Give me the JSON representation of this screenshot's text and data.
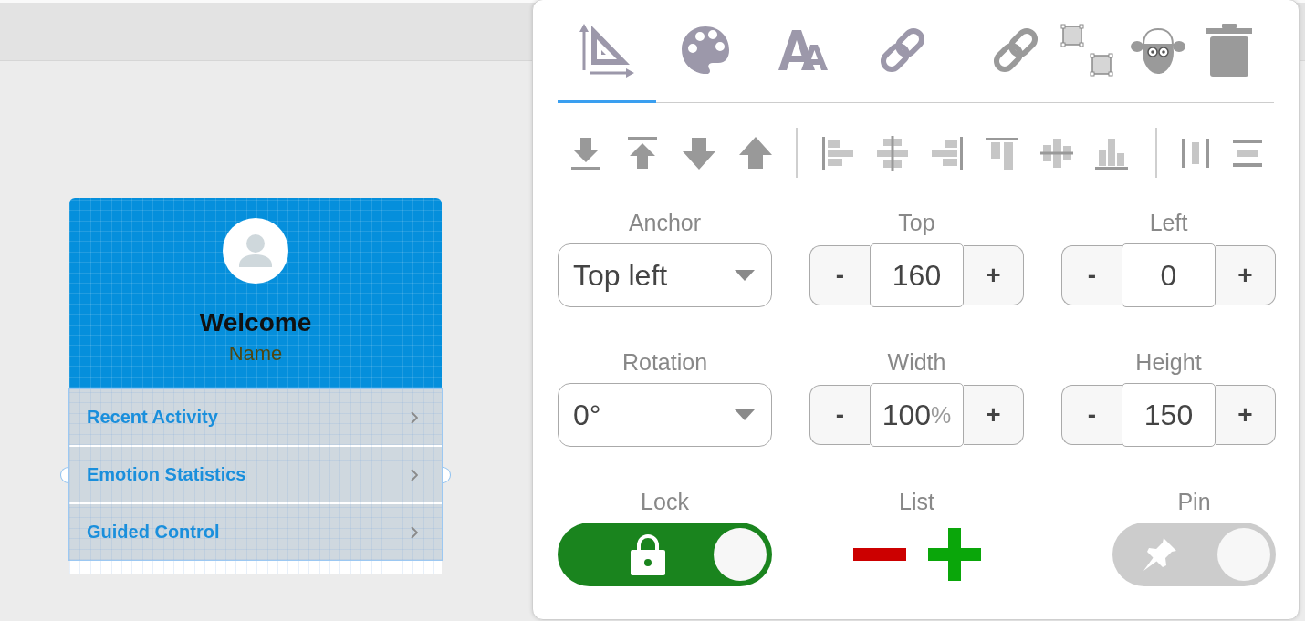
{
  "canvas": {
    "card": {
      "title": "Welcome",
      "subtitle": "Name"
    },
    "menu": {
      "selected": true,
      "items": [
        {
          "label": "Recent Activity"
        },
        {
          "label": "Emotion Statistics"
        },
        {
          "label": "Guided Control"
        }
      ]
    }
  },
  "panel": {
    "tabs": [
      {
        "kind": "layout",
        "selected": true
      },
      {
        "kind": "style",
        "selected": false
      },
      {
        "kind": "typography",
        "selected": false
      },
      {
        "kind": "link",
        "selected": false
      }
    ],
    "actions": [
      {
        "kind": "link"
      },
      {
        "kind": "group"
      },
      {
        "kind": "sheep"
      },
      {
        "kind": "delete"
      }
    ],
    "toolbar": {
      "arrange": [
        {
          "kind": "bottom"
        },
        {
          "kind": "top"
        },
        {
          "kind": "down"
        },
        {
          "kind": "up"
        }
      ],
      "align": [
        {
          "kind": "left"
        },
        {
          "kind": "center"
        },
        {
          "kind": "right"
        },
        {
          "kind": "top"
        },
        {
          "kind": "middle"
        },
        {
          "kind": "bottom"
        }
      ],
      "distribute": [
        {
          "kind": "horizontal"
        },
        {
          "kind": "vertical"
        }
      ]
    },
    "fields": [
      {
        "kind": "select",
        "label": "Anchor",
        "value": "Top left"
      },
      {
        "kind": "stepper",
        "label": "Top",
        "value": "160",
        "decrement": "-",
        "increment": "+"
      },
      {
        "kind": "stepper",
        "label": "Left",
        "value": "0",
        "decrement": "-",
        "increment": "+"
      },
      {
        "kind": "select",
        "label": "Rotation",
        "value": "0°"
      },
      {
        "kind": "stepper",
        "label": "Width",
        "value": "100",
        "unit": "%",
        "decrement": "-",
        "increment": "+"
      },
      {
        "kind": "stepper",
        "label": "Height",
        "value": "150",
        "decrement": "-",
        "increment": "+"
      },
      {
        "kind": "lock",
        "label": "Lock",
        "on": true
      },
      {
        "kind": "list",
        "label": "List"
      },
      {
        "kind": "pin",
        "label": "Pin",
        "on": false
      }
    ]
  }
}
